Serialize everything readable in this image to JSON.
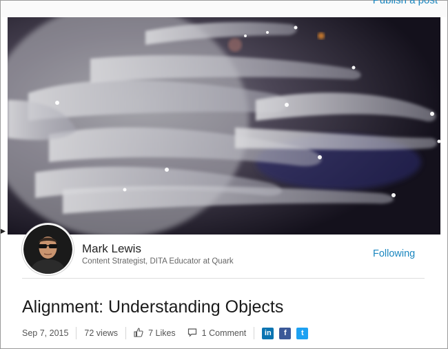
{
  "header": {
    "publish_link": "Publish a post"
  },
  "hero": {
    "image_subject": "translucent jellyfish tentacles on dark background"
  },
  "author": {
    "name": "Mark Lewis",
    "title": "Content Strategist, DITA Educator at Quark",
    "follow_status": "Following"
  },
  "post": {
    "title": "Alignment: Understanding Objects",
    "date": "Sep 7, 2015",
    "views": "72 views",
    "likes": "7 Likes",
    "comments": "1 Comment"
  },
  "share": {
    "linkedin_glyph": "in",
    "facebook_glyph": "f",
    "twitter_glyph": "t"
  },
  "icons": [
    "thumbs-up-icon",
    "comment-icon",
    "linkedin-icon",
    "facebook-icon",
    "twitter-icon"
  ],
  "colors": {
    "link": "#1a86bf",
    "linkedin": "#0a74b1",
    "facebook": "#3b5998",
    "twitter": "#1da1f2"
  }
}
